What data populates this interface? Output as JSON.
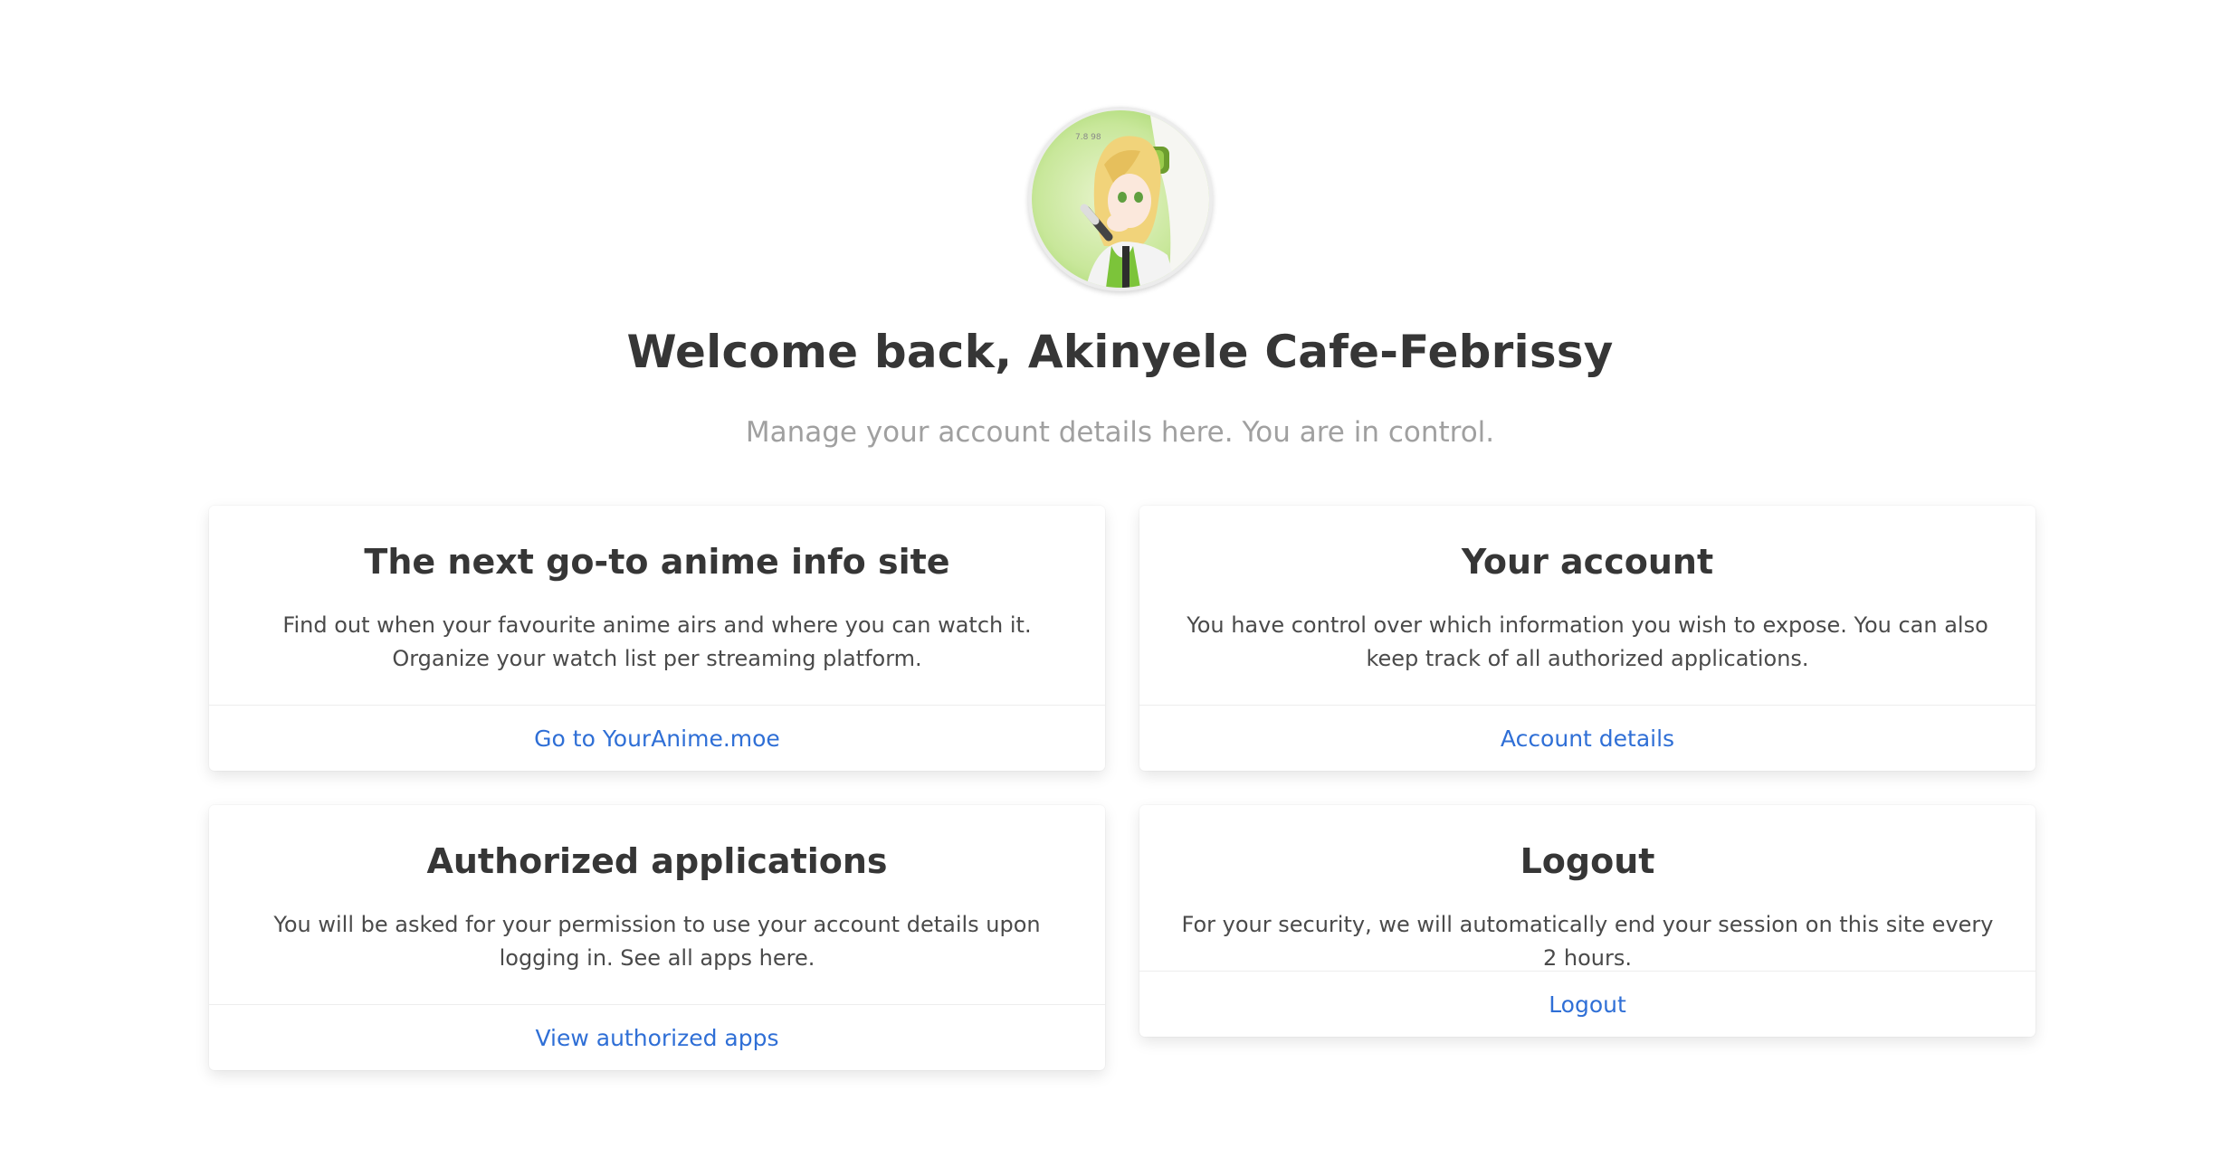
{
  "header": {
    "welcome": "Welcome back, Akinyele Cafe-Febrissy",
    "subtitle": "Manage your account details here. You are in control.",
    "avatar_icon": "anime-character-avatar"
  },
  "cards": {
    "anime": {
      "title": "The next go-to anime info site",
      "text": "Find out when your favourite anime airs and where you can watch it. Organize your watch list per streaming platform.",
      "link": "Go to YourAnime.moe"
    },
    "account": {
      "title": "Your account",
      "text": "You have control over which information you wish to expose. You can also keep track of all authorized applications.",
      "link": "Account details"
    },
    "apps": {
      "title": "Authorized applications",
      "text": "You will be asked for your permission to use your account details upon logging in. See all apps here.",
      "link": "View authorized apps"
    },
    "logout": {
      "title": "Logout",
      "text": "For your security, we will automatically end your session on this site every 2 hours.",
      "link": "Logout"
    }
  },
  "colors": {
    "link": "#2f6fd6",
    "title": "#363636",
    "subtitle": "#a0a0a0"
  }
}
